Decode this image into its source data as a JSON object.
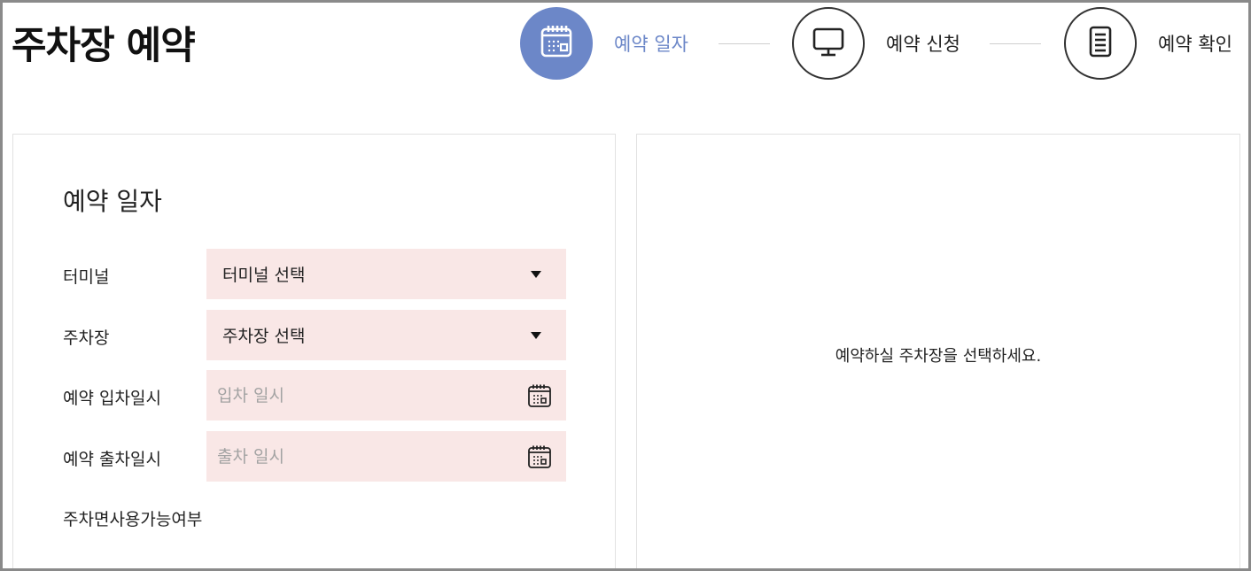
{
  "page": {
    "title": "주차장 예약"
  },
  "steps": [
    {
      "label": "예약 일자",
      "icon": "calendar-icon",
      "active": true
    },
    {
      "label": "예약 신청",
      "icon": "monitor-icon",
      "active": false
    },
    {
      "label": "예약 확인",
      "icon": "document-icon",
      "active": false
    }
  ],
  "form": {
    "section_title": "예약 일자",
    "terminal": {
      "label": "터미널",
      "value": "터미널 선택"
    },
    "parking": {
      "label": "주차장",
      "value": "주차장 선택"
    },
    "entry": {
      "label": "예약 입차일시",
      "placeholder": "입차 일시",
      "value": ""
    },
    "exit": {
      "label": "예약 출차일시",
      "placeholder": "출차 일시",
      "value": ""
    },
    "availability_label": "주차면사용가능여부"
  },
  "right_panel": {
    "message": "예약하실 주차장을 선택하세요."
  },
  "colors": {
    "accent": "#6c87c8",
    "field_bg": "#f9e7e6",
    "border": "#e2e2e2",
    "frame": "#8a8a8a"
  }
}
